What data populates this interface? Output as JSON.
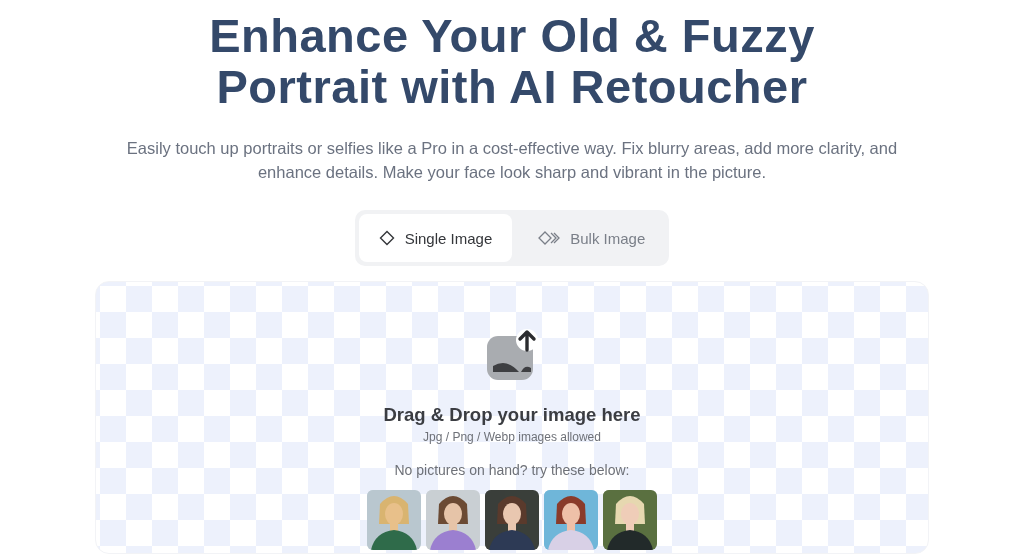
{
  "heading": {
    "line_1": "Enhance Your Old & Fuzzy",
    "line_2": "Portrait with AI Retoucher"
  },
  "subtitle": "Easily touch up portraits or selfies like a Pro in a cost-effective way. Fix blurry areas, add more clarity, and enhance details. Make your face look sharp and vibrant in the picture.",
  "tabs": [
    {
      "label": "Single Image",
      "selected": true,
      "kind": "single"
    },
    {
      "label": "Bulk Image",
      "selected": false,
      "kind": "bulk"
    }
  ],
  "upload": {
    "title": "Drag & Drop your image here",
    "formats": "Jpg / Png / Webp images allowed",
    "samples_prompt": "No pictures on hand? try these below:"
  }
}
